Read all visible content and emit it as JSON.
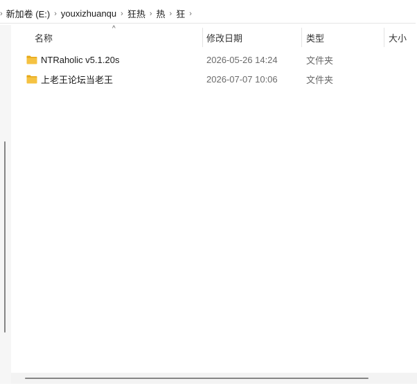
{
  "breadcrumb": {
    "items": [
      {
        "label": "新加卷 (E:)"
      },
      {
        "label": "youxizhuanqu"
      },
      {
        "label": "狂热"
      },
      {
        "label": "热"
      },
      {
        "label": "狂"
      }
    ]
  },
  "columns": {
    "name": "名称",
    "modified": "修改日期",
    "type": "类型",
    "size": "大小",
    "sort_indicator": "^"
  },
  "files": [
    {
      "name": "NTRaholic v5.1.20s",
      "modified": "2026-05-26 14:24",
      "type": "文件夹",
      "icon": "folder-icon"
    },
    {
      "name": "上老王论坛当老王",
      "modified": "2026-07-07 10:06",
      "type": "文件夹",
      "icon": "folder-icon"
    }
  ],
  "colors": {
    "folder_body": "#f5c242",
    "folder_tab": "#e6a817",
    "scroll_thumb": "#858585"
  }
}
